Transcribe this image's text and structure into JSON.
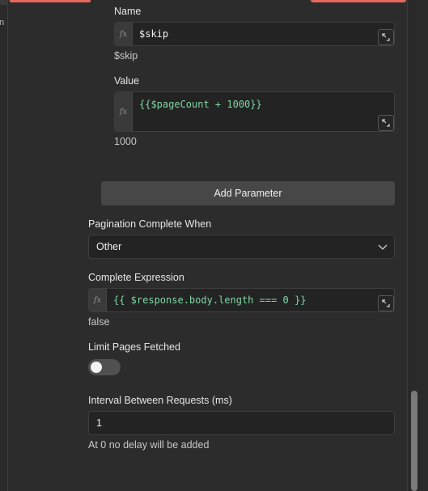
{
  "left_rail": {
    "fragment_char": "n"
  },
  "params": {
    "name_label": "Name",
    "name_value": "$skip",
    "name_preview": "$skip",
    "value_label": "Value",
    "value_expression": "{{$pageCount + 1000}}",
    "value_preview": "1000"
  },
  "add_parameter_label": "Add Parameter",
  "pagination": {
    "complete_when_label": "Pagination Complete When",
    "complete_when_selected": "Other",
    "complete_expression_label": "Complete Expression",
    "complete_expression_value": "{{ $response.body.length === 0 }}",
    "complete_expression_preview": "false"
  },
  "limit": {
    "label": "Limit Pages Fetched",
    "enabled": false
  },
  "interval": {
    "label": "Interval Between Requests (ms)",
    "value": "1",
    "hint": "At 0 no delay will be added"
  },
  "fx_glyph": "fx",
  "colors": {
    "accent": "#e7685d",
    "expression_text": "#7fd6a4",
    "background": "#2c2c2c"
  },
  "icons": [
    "expand-icon",
    "chevron-down-icon"
  ]
}
